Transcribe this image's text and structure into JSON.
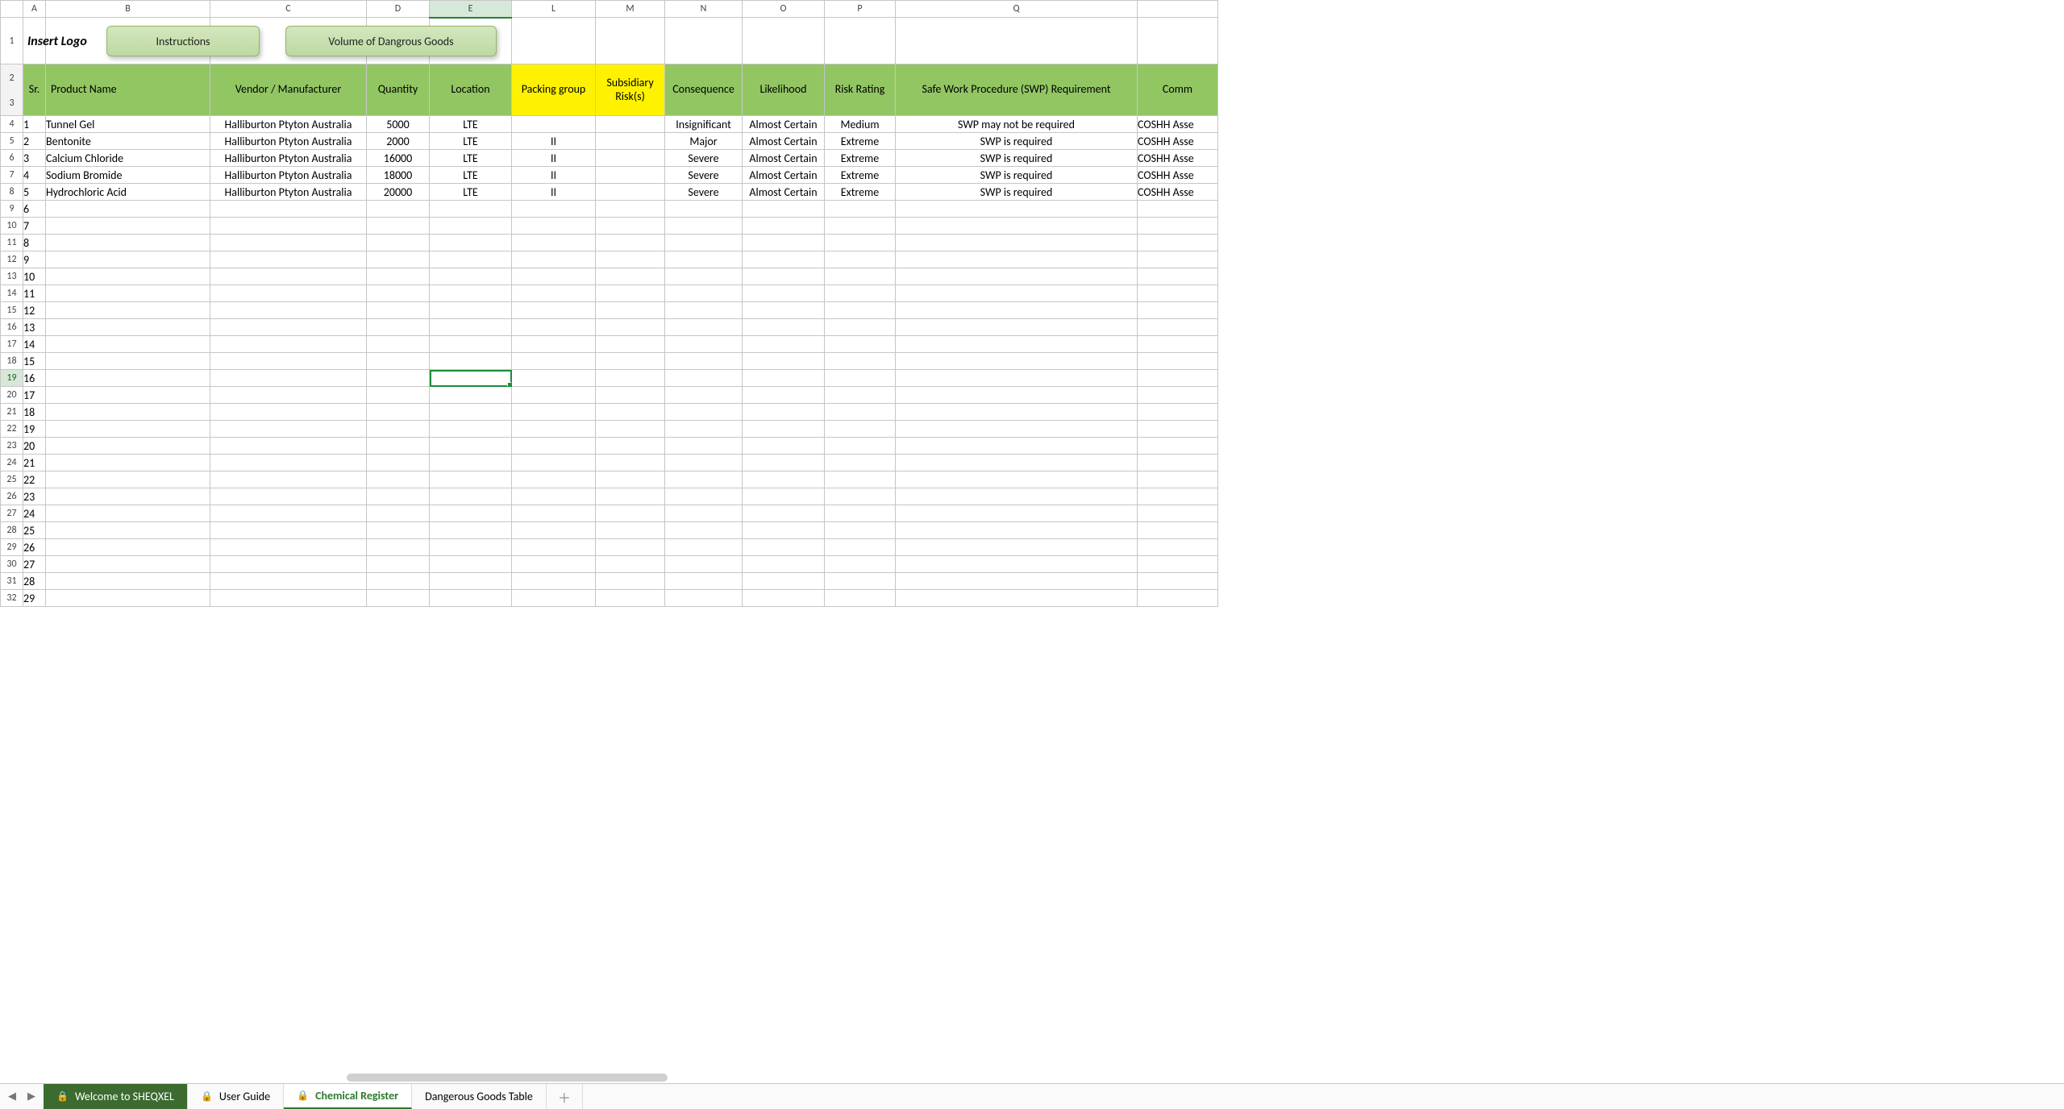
{
  "columns": {
    "A": "A",
    "B": "B",
    "C": "C",
    "D": "D",
    "E": "E",
    "L": "L",
    "M": "M",
    "N": "N",
    "O": "O",
    "P": "P",
    "Q": "Q"
  },
  "row1": {
    "insert_logo": "Insert Logo",
    "btn_instructions": "Instructions",
    "btn_volume": "Volume of Dangrous Goods"
  },
  "headers": {
    "sr": "Sr.",
    "product_name": "Product Name",
    "vendor": "Vendor / Manufacturer",
    "quantity": "Quantity",
    "location": "Location",
    "packing_group": "Packing group",
    "subsidiary_risks": "Subsidiary Risk(s)",
    "consequence": "Consequence",
    "likelihood": "Likelihood",
    "risk_rating": "Risk Rating",
    "swp": "Safe Work Procedure (SWP) Requirement",
    "comm": "Comm"
  },
  "rows": [
    {
      "sr": "1",
      "product": "Tunnel Gel",
      "vendor": "Halliburton Ptyton Australia",
      "qty": "5000",
      "loc": "LTE",
      "pg": "",
      "sub": "",
      "cons": "Insignificant",
      "like": "Almost Certain",
      "risk": "Medium",
      "risk_class": "risk-medium",
      "swp": "SWP may not be required",
      "comm": "COSHH Asse"
    },
    {
      "sr": "2",
      "product": "Bentonite",
      "vendor": "Halliburton Ptyton Australia",
      "qty": "2000",
      "loc": "LTE",
      "pg": "II",
      "sub": "",
      "cons": "Major",
      "like": "Almost Certain",
      "risk": "Extreme",
      "risk_class": "risk-extreme",
      "swp": "SWP is required",
      "comm": "COSHH Asse"
    },
    {
      "sr": "3",
      "product": "Calcium Chloride",
      "vendor": "Halliburton Ptyton Australia",
      "qty": "16000",
      "loc": "LTE",
      "pg": "II",
      "sub": "",
      "cons": "Severe",
      "like": "Almost Certain",
      "risk": "Extreme",
      "risk_class": "risk-extreme",
      "swp": "SWP is required",
      "comm": "COSHH Asse"
    },
    {
      "sr": "4",
      "product": "Sodium Bromide",
      "vendor": "Halliburton Ptyton Australia",
      "qty": "18000",
      "loc": "LTE",
      "pg": "II",
      "sub": "",
      "cons": "Severe",
      "like": "Almost Certain",
      "risk": "Extreme",
      "risk_class": "risk-extreme",
      "swp": "SWP is required",
      "comm": "COSHH Asse"
    },
    {
      "sr": "5",
      "product": "Hydrochloric Acid",
      "vendor": "Halliburton Ptyton Australia",
      "qty": "20000",
      "loc": "LTE",
      "pg": "II",
      "sub": "",
      "cons": "Severe",
      "like": "Almost Certain",
      "risk": "Extreme",
      "risk_class": "risk-extreme",
      "swp": "SWP is required",
      "comm": "COSHH Asse"
    }
  ],
  "empty_start": 6,
  "empty_end": 29,
  "row_labels": [
    "1",
    "2",
    "3",
    "4",
    "5",
    "6",
    "7",
    "8",
    "9",
    "10",
    "11",
    "12",
    "13",
    "14",
    "15",
    "16",
    "17",
    "18",
    "19",
    "20",
    "21",
    "22",
    "23",
    "24",
    "25",
    "26",
    "27",
    "28",
    "29",
    "30",
    "31",
    "32"
  ],
  "selected_row_label": 19,
  "tabs": {
    "welcome": "Welcome to SHEQXEL",
    "user_guide": "User Guide",
    "chemical_register": "Chemical Register",
    "dgt": "Dangerous Goods Table"
  }
}
